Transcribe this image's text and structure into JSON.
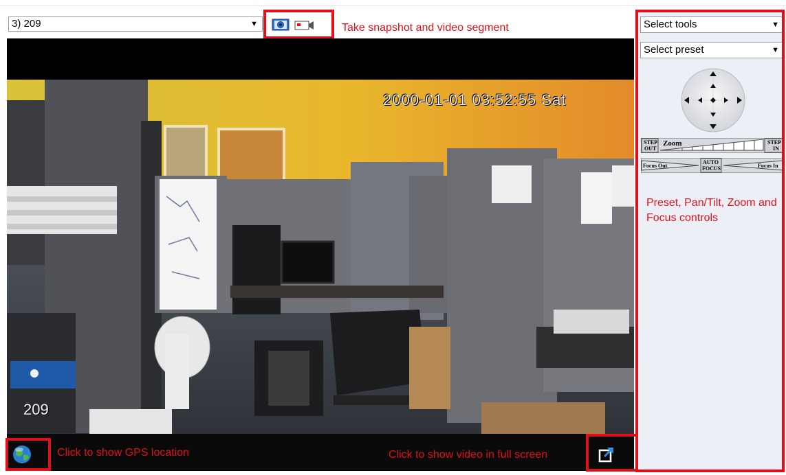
{
  "camera_select": {
    "value": "3) 209"
  },
  "annotations": {
    "snapshot": "Take snapshot and video segment",
    "controls": "Preset, Pan/Tilt, Zoom and Focus controls",
    "gps": "Click to show GPS location",
    "fullscreen": "Click to show video in full screen"
  },
  "tools_select": {
    "value": "Select tools"
  },
  "preset_select": {
    "value": "Select preset"
  },
  "zoom_bar": {
    "step_out": [
      "STEP",
      "OUT"
    ],
    "label": "Zoom",
    "step_in": [
      "STEP",
      "IN"
    ]
  },
  "focus_bar": {
    "out": "Focus Out",
    "auto": [
      "AUTO",
      "FOCUS"
    ],
    "in": "Focus In"
  },
  "video": {
    "timestamp": "2000-01-01 03:52:55 Sat",
    "camera_label": "209"
  },
  "colors": {
    "highlight": "#e0101b",
    "panel": "#eceff6"
  }
}
